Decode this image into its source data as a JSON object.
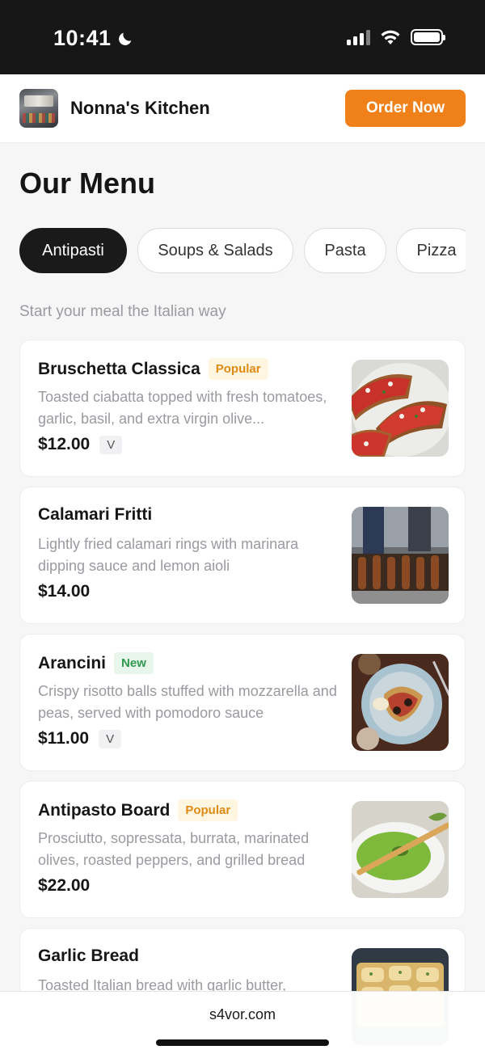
{
  "status_bar": {
    "time": "10:41"
  },
  "header": {
    "brand": "Nonna's Kitchen",
    "order_button": "Order Now"
  },
  "page_title": "Our Menu",
  "categories": [
    {
      "label": "Antipasti",
      "active": true
    },
    {
      "label": "Soups & Salads",
      "active": false
    },
    {
      "label": "Pasta",
      "active": false
    },
    {
      "label": "Pizza",
      "active": false
    }
  ],
  "section_subtitle": "Start your meal the Italian way",
  "menu_items": [
    {
      "name": "Bruschetta Classica",
      "badge": "Popular",
      "description": "Toasted ciabatta topped with fresh tomatoes, garlic, basil, and extra virgin olive...",
      "price": "$12.00",
      "tag": "V"
    },
    {
      "name": "Calamari Fritti",
      "badge": "",
      "description": "Lightly fried calamari rings with marinara dipping sauce and lemon aioli",
      "price": "$14.00",
      "tag": ""
    },
    {
      "name": "Arancini",
      "badge": "New",
      "description": "Crispy risotto balls stuffed with mozzarella and peas, served with pomodoro sauce",
      "price": "$11.00",
      "tag": "V"
    },
    {
      "name": "Antipasto Board",
      "badge": "Popular",
      "description": "Prosciutto, sopressata, burrata, marinated olives, roasted peppers, and grilled bread",
      "price": "$22.00",
      "tag": ""
    },
    {
      "name": "Garlic Bread",
      "badge": "",
      "description": "Toasted Italian bread with garlic butter,",
      "price": "",
      "tag": ""
    }
  ],
  "browser": {
    "url": "s4vor.com"
  },
  "colors": {
    "accent": "#f0801a",
    "popular_badge": "#e08a14",
    "new_badge": "#2f9a4f",
    "active_pill": "#1a1a1a"
  }
}
